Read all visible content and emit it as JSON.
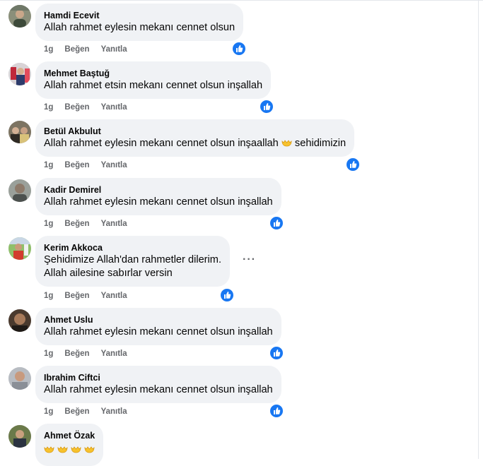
{
  "comments": [
    {
      "author": "Hamdi Ecevit",
      "lines": [
        "Allah rahmet eylesin mekanı cennet olsun"
      ],
      "time": "1g",
      "like": "Beğen",
      "reply": "Yanıtla",
      "reaction_icon": "like-reaction-icon"
    },
    {
      "author": "Mehmet Baştuğ",
      "lines": [
        "Allah rahmet etsin mekanı cennet olsun inşallah"
      ],
      "time": "1g",
      "like": "Beğen",
      "reply": "Yanıtla",
      "reaction_icon": "like-reaction-icon"
    },
    {
      "author": "Betül Akbulut",
      "lines": [
        "Allah rahmet eylesin mekanı cennet olsun inşaallah"
      ],
      "text_suffix": "sehidimizin",
      "emoji": "palms-up-together",
      "time": "1g",
      "like": "Beğen",
      "reply": "Yanıtla",
      "reaction_icon": "like-reaction-icon"
    },
    {
      "author": "Kadir Demirel",
      "lines": [
        "Allah rahmet eylesin mekanı cennet olsun inşallah"
      ],
      "time": "1g",
      "like": "Beğen",
      "reply": "Yanıtla",
      "reaction_icon": "like-reaction-icon"
    },
    {
      "author": "Kerim Akkoca",
      "lines": [
        "Şehidimize Allah'dan rahmetler dilerim.",
        "Allah ailesine sabırlar versin"
      ],
      "time": "1g",
      "like": "Beğen",
      "reply": "Yanıtla",
      "reaction_icon": "like-reaction-icon",
      "more_label": "···"
    },
    {
      "author": "Ahmet Uslu",
      "lines": [
        "Allah rahmet eylesin mekanı cennet olsun inşallah"
      ],
      "time": "1g",
      "like": "Beğen",
      "reply": "Yanıtla",
      "reaction_icon": "like-reaction-icon"
    },
    {
      "author": "Ibrahim Ciftci",
      "lines": [
        "Allah rahmet eylesin mekanı cennet olsun inşallah"
      ],
      "time": "1g",
      "like": "Beğen",
      "reply": "Yanıtla",
      "reaction_icon": "like-reaction-icon"
    },
    {
      "author": "Ahmet Özak",
      "emoji_count": 4,
      "emoji": "palms-up-together"
    }
  ],
  "colors": {
    "bubble": "#f0f2f5",
    "secondary_text": "#65676b",
    "like_blue": "#1877f2",
    "emoji_yellow": "#f7c22d"
  }
}
